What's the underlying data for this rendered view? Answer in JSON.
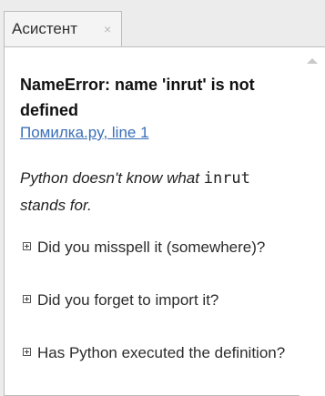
{
  "tab": {
    "label": "Асистент",
    "close_glyph": "×"
  },
  "error": {
    "title": "NameError: name 'inrut' is not defined",
    "location_link": "Помилка.py, line 1"
  },
  "explanation": {
    "prefix": "Python doesn't know what ",
    "code": "inrut",
    "suffix": " stands for."
  },
  "hints": [
    {
      "text": "Did you misspell it (somewhere)?"
    },
    {
      "text": "Did you forget to import it?"
    },
    {
      "text": "Has Python executed the definition?"
    }
  ],
  "icons": {
    "expand": "plus-box-icon",
    "scroll_up": "chevron-up-icon",
    "close": "close-icon"
  },
  "colors": {
    "link": "#3a6fb8",
    "panel_bg": "#ffffff",
    "chrome_bg": "#ececec"
  }
}
